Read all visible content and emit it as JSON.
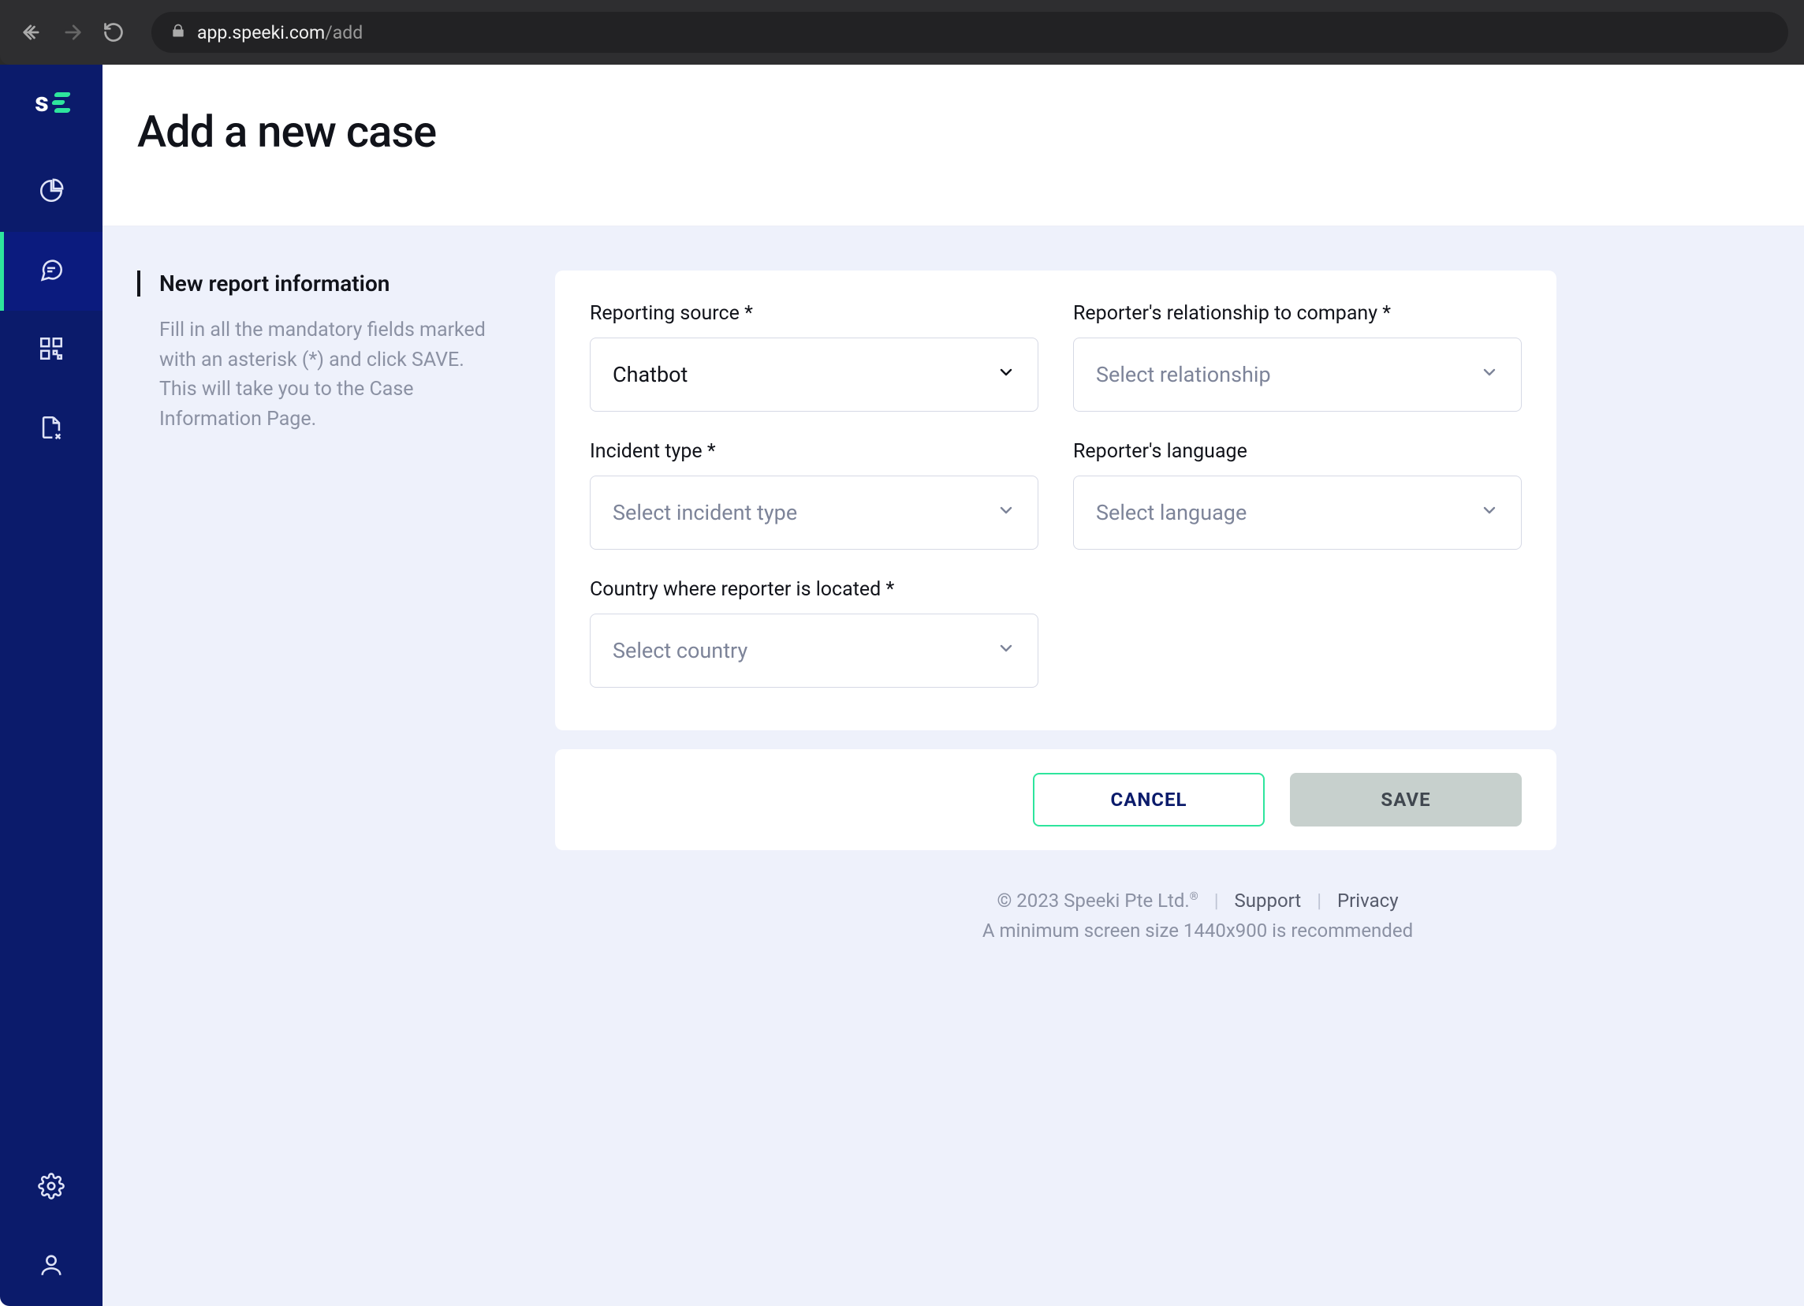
{
  "browser": {
    "url_host": "app.speeki.com",
    "url_path": "/add"
  },
  "page": {
    "title": "Add a new case"
  },
  "side_info": {
    "title": "New report information",
    "desc": "Fill in all the mandatory fields marked with an asterisk (*) and click SAVE. This will take you to the Case Information Page."
  },
  "fields": {
    "reporting_source": {
      "label": "Reporting source *",
      "value": "Chatbot"
    },
    "relationship": {
      "label": "Reporter's relationship to company *",
      "placeholder": "Select relationship"
    },
    "incident_type": {
      "label": "Incident type *",
      "placeholder": "Select incident type"
    },
    "language": {
      "label": "Reporter's language",
      "placeholder": "Select language"
    },
    "country": {
      "label": "Country where reporter is located *",
      "placeholder": "Select country"
    }
  },
  "actions": {
    "cancel": "CANCEL",
    "save": "SAVE"
  },
  "footer": {
    "copyright": "© 2023 Speeki Pte Ltd.",
    "support": "Support",
    "privacy": "Privacy",
    "recommendation": "A minimum screen size 1440x900 is recommended"
  }
}
